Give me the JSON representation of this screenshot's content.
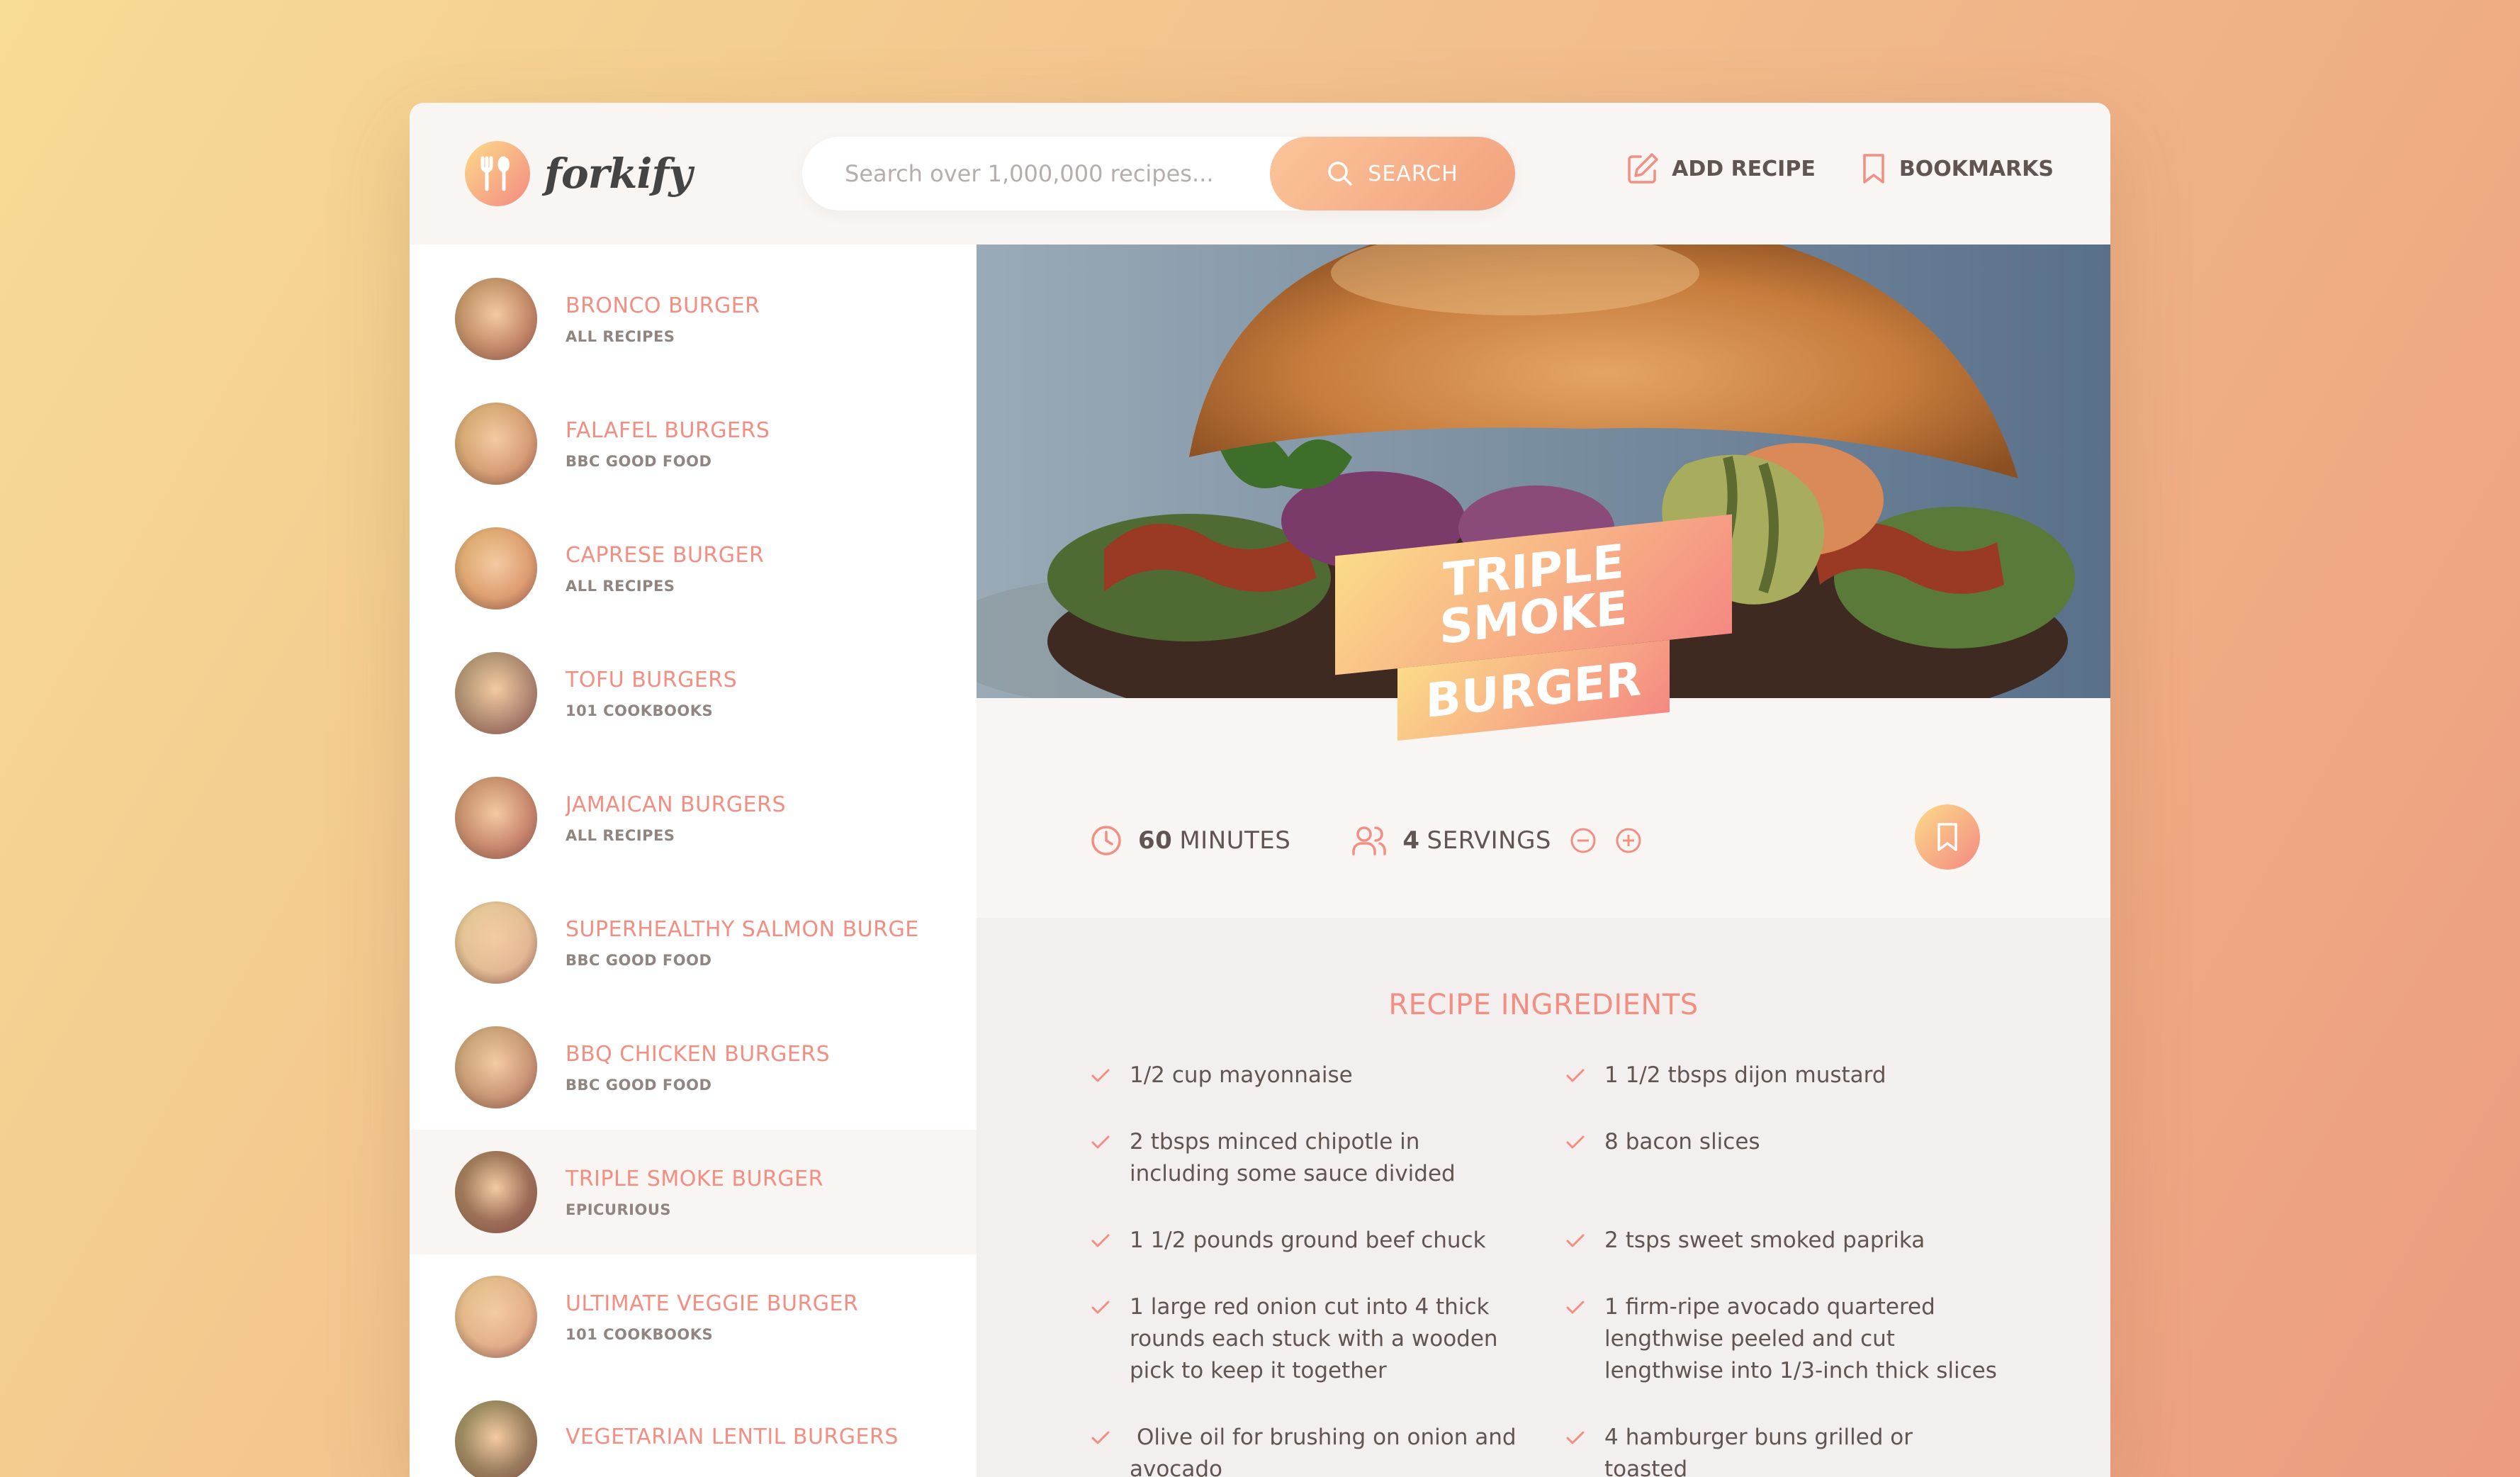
{
  "header": {
    "logo_text": "forkify",
    "search": {
      "placeholder": "Search over 1,000,000 recipes...",
      "button_label": "SEARCH"
    },
    "nav": {
      "add_recipe": "ADD RECIPE",
      "bookmarks": "BOOKMARKS"
    }
  },
  "results": [
    {
      "title": "BRONCO BURGER",
      "publisher": "ALL RECIPES",
      "thumb_color": "#a87a5a"
    },
    {
      "title": "FALAFEL BURGERS",
      "publisher": "BBC GOOD FOOD",
      "thumb_color": "#c49a6c"
    },
    {
      "title": "CAPRESE BURGER",
      "publisher": "ALL RECIPES",
      "thumb_color": "#d09a66"
    },
    {
      "title": "TOFU BURGERS",
      "publisher": "101 COOKBOOKS",
      "thumb_color": "#8c7a6a"
    },
    {
      "title": "JAMAICAN BURGERS",
      "publisher": "ALL RECIPES",
      "thumb_color": "#b07862"
    },
    {
      "title": "SUPERHEALTHY SALMON BURGE...",
      "publisher": "BBC GOOD FOOD",
      "thumb_color": "#d8c49c"
    },
    {
      "title": "BBQ CHICKEN BURGERS",
      "publisher": "BBC GOOD FOOD",
      "thumb_color": "#b29070"
    },
    {
      "title": "TRIPLE SMOKE BURGER",
      "publisher": "EPICURIOUS",
      "thumb_color": "#6e5040",
      "active": true
    },
    {
      "title": "ULTIMATE VEGGIE BURGER",
      "publisher": "101 COOKBOOKS",
      "thumb_color": "#d8b48c"
    },
    {
      "title": "VEGETARIAN LENTIL BURGERS",
      "publisher": "",
      "thumb_color": "#6a6a4a"
    }
  ],
  "recipe": {
    "title_line1": "TRIPLE SMOKE",
    "title_line2": "BURGER",
    "cooking_time": "60",
    "cooking_time_unit": "MINUTES",
    "servings": "4",
    "servings_unit": "SERVINGS",
    "ingredients_heading": "RECIPE INGREDIENTS",
    "ingredients": [
      {
        "quantity": "1/2",
        "description": "cup mayonnaise"
      },
      {
        "quantity": "1 1/2",
        "description": "tbsps dijon mustard"
      },
      {
        "quantity": "2",
        "description": "tbsps minced chipotle in including some sauce divided"
      },
      {
        "quantity": "8",
        "description": "bacon slices"
      },
      {
        "quantity": "1 1/2",
        "description": "pounds ground beef chuck"
      },
      {
        "quantity": "2",
        "description": "tsps sweet smoked paprika"
      },
      {
        "quantity": "1",
        "description": "large red onion cut into 4 thick rounds each stuck with a wooden pick to keep it together"
      },
      {
        "quantity": "1",
        "description": "firm-ripe avocado quartered lengthwise peeled and cut lengthwise into 1/3-inch thick slices"
      },
      {
        "quantity": "",
        "description": "Olive oil for brushing on onion and avocado"
      },
      {
        "quantity": "4",
        "description": "hamburger buns grilled or toasted"
      }
    ]
  },
  "colors": {
    "accent": "#f38e82",
    "gradient_start": "#fbdb89",
    "gradient_end": "#f48982",
    "text": "#615551",
    "header_bg": "#f9f5f3"
  },
  "icons": {
    "logo": "fork-knife-icon",
    "search": "search-icon",
    "add_recipe": "edit-icon",
    "bookmarks": "bookmark-icon",
    "time": "clock-icon",
    "servings": "users-icon",
    "decrease": "minus-circle-icon",
    "increase": "plus-circle-icon",
    "ingredient": "check-icon"
  }
}
